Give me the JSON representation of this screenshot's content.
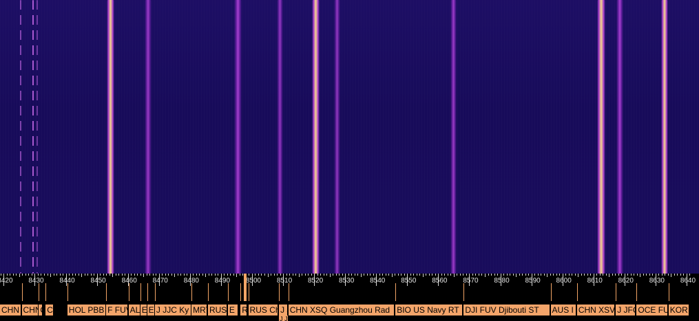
{
  "colors": {
    "background": "#170b5a",
    "signal_violet": "#a62fd6",
    "signal_bright": "#f5d98a",
    "station_label": "#f4a56a"
  },
  "frequency_scale": {
    "unit": "kHz",
    "ticks": [
      "8420",
      "8430",
      "8440",
      "8450",
      "8460",
      "8470",
      "8480",
      "8490",
      "8500",
      "8510",
      "8520",
      "8530",
      "8540",
      "8550",
      "8560",
      "8570",
      "8580",
      "8590",
      "8600",
      "8610",
      "8620",
      "8630",
      "8640"
    ],
    "range": [
      8418,
      8641
    ]
  },
  "signals": [
    {
      "freq": 8425.5,
      "width_khz": 0.3,
      "intensity": 0.5,
      "dashed": true
    },
    {
      "freq": 8429.5,
      "width_khz": 0.4,
      "intensity": 0.7,
      "dashed": true
    },
    {
      "freq": 8430.8,
      "width_khz": 0.3,
      "intensity": 0.4,
      "dashed": true
    },
    {
      "freq": 8454.5,
      "width_khz": 2.4,
      "intensity": 0.9
    },
    {
      "freq": 8466.5,
      "width_khz": 2.2,
      "intensity": 0.55
    },
    {
      "freq": 8495.5,
      "width_khz": 2.4,
      "intensity": 0.6
    },
    {
      "freq": 8509.0,
      "width_khz": 2.0,
      "intensity": 0.5
    },
    {
      "freq": 8520.5,
      "width_khz": 2.4,
      "intensity": 0.85
    },
    {
      "freq": 8527.5,
      "width_khz": 2.0,
      "intensity": 0.5
    },
    {
      "freq": 8565.0,
      "width_khz": 2.0,
      "intensity": 0.55
    },
    {
      "freq": 8612.5,
      "width_khz": 2.6,
      "intensity": 1.0
    },
    {
      "freq": 8618.5,
      "width_khz": 2.2,
      "intensity": 0.6
    },
    {
      "freq": 8633.0,
      "width_khz": 2.2,
      "intensity": 1.0
    }
  ],
  "stations": [
    {
      "label": "CHN",
      "freq_start": 8418.2,
      "freq_end": 8425.6
    },
    {
      "label": "CHN",
      "freq_start": 8425.8,
      "freq_end": 8431.2
    },
    {
      "label": "C",
      "freq_start": 8431.3,
      "freq_end": 8432.5
    },
    {
      "label": "CHN",
      "freq_start": 8433.5,
      "freq_end": 8436.0
    },
    {
      "label": "HOL PBB N",
      "freq_start": 8440.5,
      "freq_end": 8453.0
    },
    {
      "label": "F FUV",
      "freq_start": 8453.0,
      "freq_end": 8460.0
    },
    {
      "label": "AL",
      "freq_start": 8460.2,
      "freq_end": 8464.0
    },
    {
      "label": "E",
      "freq_start": 8464.0,
      "freq_end": 8466.2
    },
    {
      "label": "E",
      "freq_start": 8466.2,
      "freq_end": 8468.7
    },
    {
      "label": "J JJC Ky",
      "freq_start": 8468.7,
      "freq_end": 8480.5
    },
    {
      "label": "MRT",
      "freq_start": 8480.5,
      "freq_end": 8485.5
    },
    {
      "label": "RUS",
      "freq_start": 8485.8,
      "freq_end": 8492.0
    },
    {
      "label": "E",
      "freq_start": 8492.2,
      "freq_end": 8495.5
    },
    {
      "label": "R",
      "freq_start": 8496.3,
      "freq_end": 8498.5
    },
    {
      "label": "RUS Ch",
      "freq_start": 8498.8,
      "freq_end": 8508.5
    },
    {
      "label": "J JF",
      "freq_start": 8508.7,
      "freq_end": 8511.5
    },
    {
      "label": "CHN XSQ Guangzhou Rad",
      "freq_start": 8511.7,
      "freq_end": 8546.0
    },
    {
      "label": "BIO US Navy RT",
      "freq_start": 8546.2,
      "freq_end": 8568.0
    },
    {
      "label": "DJI FUV Djibouti ST",
      "freq_start": 8568.2,
      "freq_end": 8596.0
    },
    {
      "label": "AUS I",
      "freq_start": 8596.2,
      "freq_end": 8604.5
    },
    {
      "label": "CHN XSV Tia",
      "freq_start": 8604.7,
      "freq_end": 8617.0
    },
    {
      "label": "J JFC I",
      "freq_start": 8617.2,
      "freq_end": 8623.7
    },
    {
      "label": "OCE FU",
      "freq_start": 8623.9,
      "freq_end": 8634.0
    },
    {
      "label": "KOR",
      "freq_start": 8634.2,
      "freq_end": 8641.0
    }
  ],
  "stations_second_row": [
    {
      "label": "J JF",
      "freq_start": 8508.7,
      "freq_end": 8511.5
    }
  ]
}
